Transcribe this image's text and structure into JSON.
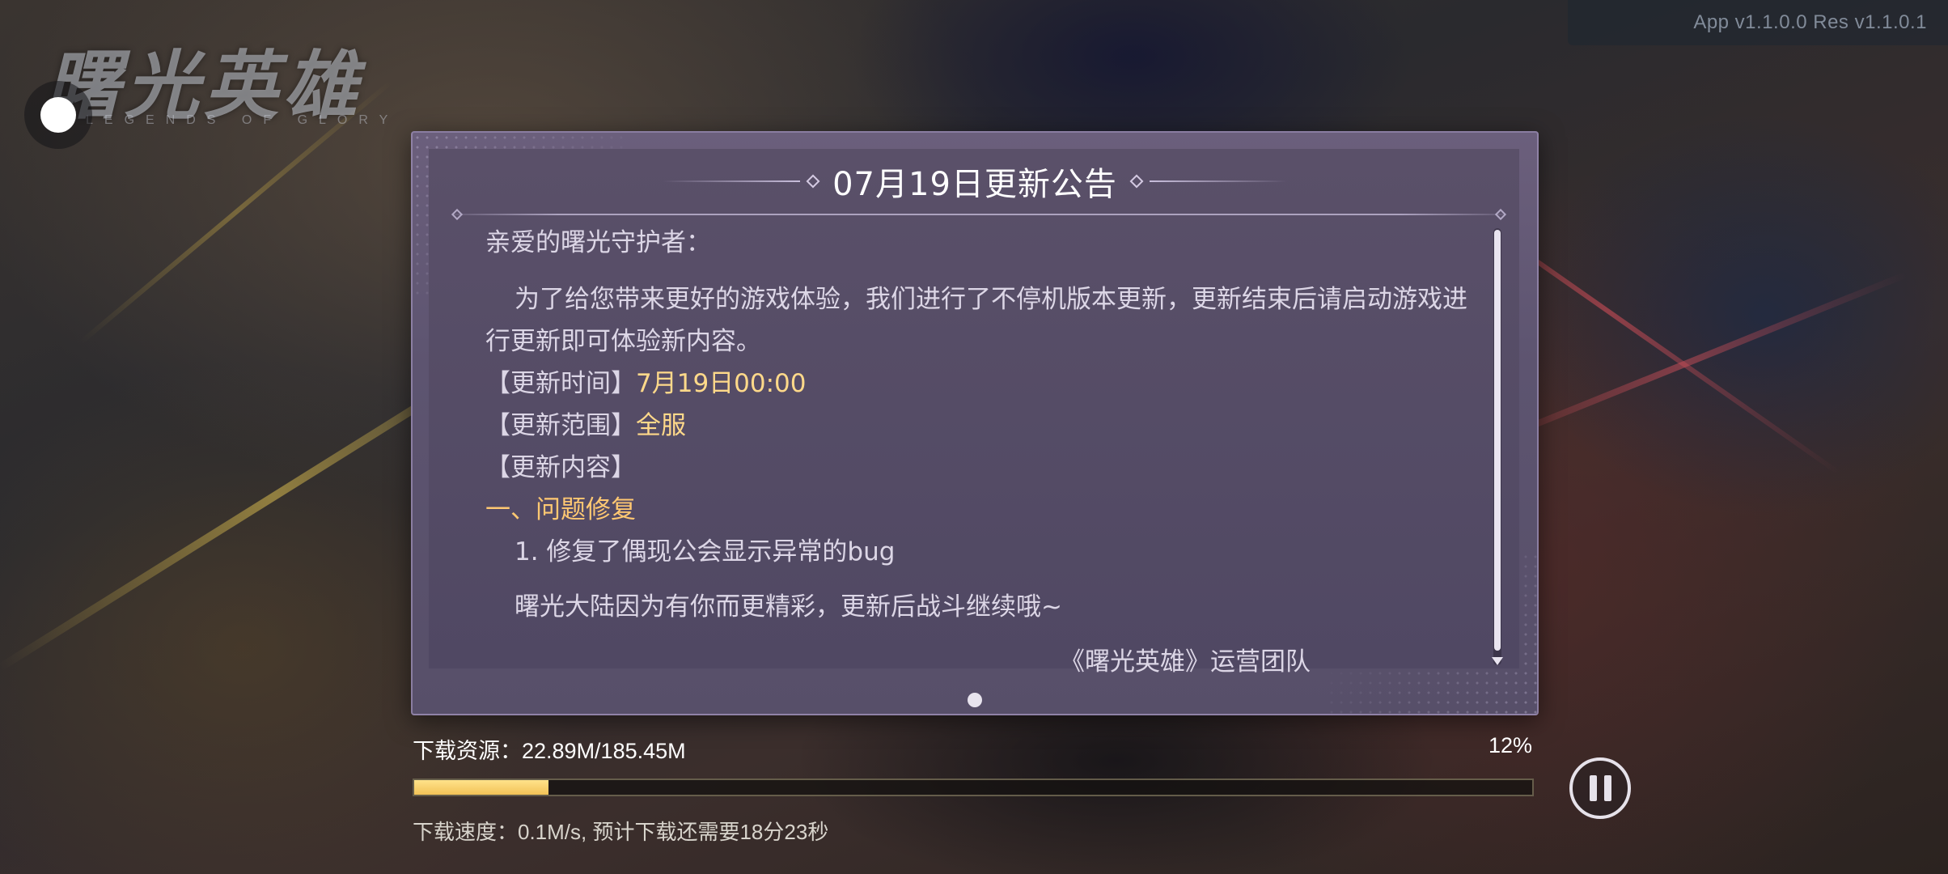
{
  "app": {
    "version_text": "App v1.1.0.0  Res v1.1.0.1",
    "logo_title": "曙光英雄",
    "logo_subtitle": "LEGENDS OF GLORY"
  },
  "notice": {
    "title": "07月19日更新公告",
    "greeting": "亲爱的曙光守护者：",
    "intro": "为了给您带来更好的游戏体验，我们进行了不停机版本更新，更新结束后请启动游戏进行更新即可体验新内容。",
    "update_time_label": "【更新时间】",
    "update_time_value": "7月19日00:00",
    "update_scope_label": "【更新范围】",
    "update_scope_value": "全服",
    "update_content_label": "【更新内容】",
    "section_title": "一、问题修复",
    "items": [
      "1. 修复了偶现公会显示异常的bug"
    ],
    "closing": "曙光大陆因为有你而更精彩，更新后战斗继续哦~",
    "signature": "《曙光英雄》运营团队",
    "page_count": 1,
    "current_page": 1
  },
  "download": {
    "label": "下载资源：22.89M/185.45M",
    "percent_text": "12%",
    "progress_fraction": 0.12,
    "speed_text": "下载速度：0.1M/s, 预计下载还需要18分23秒",
    "progress_color": "#f2c257"
  },
  "icons": {
    "pause": "pause-icon",
    "float_assist": "floating-assist-icon"
  }
}
